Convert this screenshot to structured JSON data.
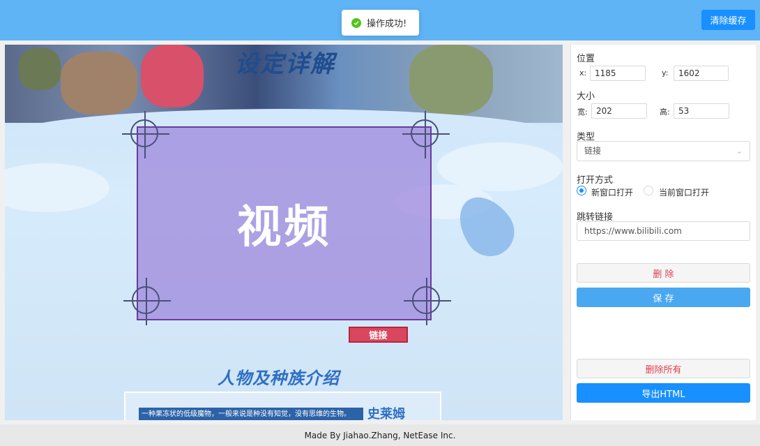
{
  "header": {
    "toast_text": "操作成功!",
    "clear_cache_label": "清除缓存"
  },
  "canvas": {
    "banner_title": "设定详解",
    "overlay_label": "视频",
    "link_badge": "链接",
    "section_title": "人物及种族介绍",
    "info_text": "一种果冻状的低级魔物，一般来说是种没有知觉，没有思维的生物。",
    "character_name": "史莱姆"
  },
  "panel": {
    "position_label": "位置",
    "x_label": "x:",
    "x_value": "1185",
    "y_label": "y:",
    "y_value": "1602",
    "size_label": "大小",
    "width_label": "宽:",
    "width_value": "202",
    "height_label": "高:",
    "height_value": "53",
    "type_label": "类型",
    "type_value": "链接",
    "open_mode_label": "打开方式",
    "open_new_label": "新窗口打开",
    "open_current_label": "当前窗口打开",
    "open_mode_selected": "新窗口打开",
    "link_label": "跳转链接",
    "link_value": "https://www.bilibili.com",
    "delete_label": "删 除",
    "save_label": "保 存",
    "delete_all_label": "删除所有",
    "export_label": "导出HTML"
  },
  "footer": {
    "credit": "Made By Jiahao.Zhang, NetEase Inc."
  },
  "colors": {
    "header_bg": "#5fb4f5",
    "primary": "#1890ff",
    "overlay": "#a08cdc",
    "link_badge": "#d8475e",
    "danger_text": "#e04050"
  }
}
